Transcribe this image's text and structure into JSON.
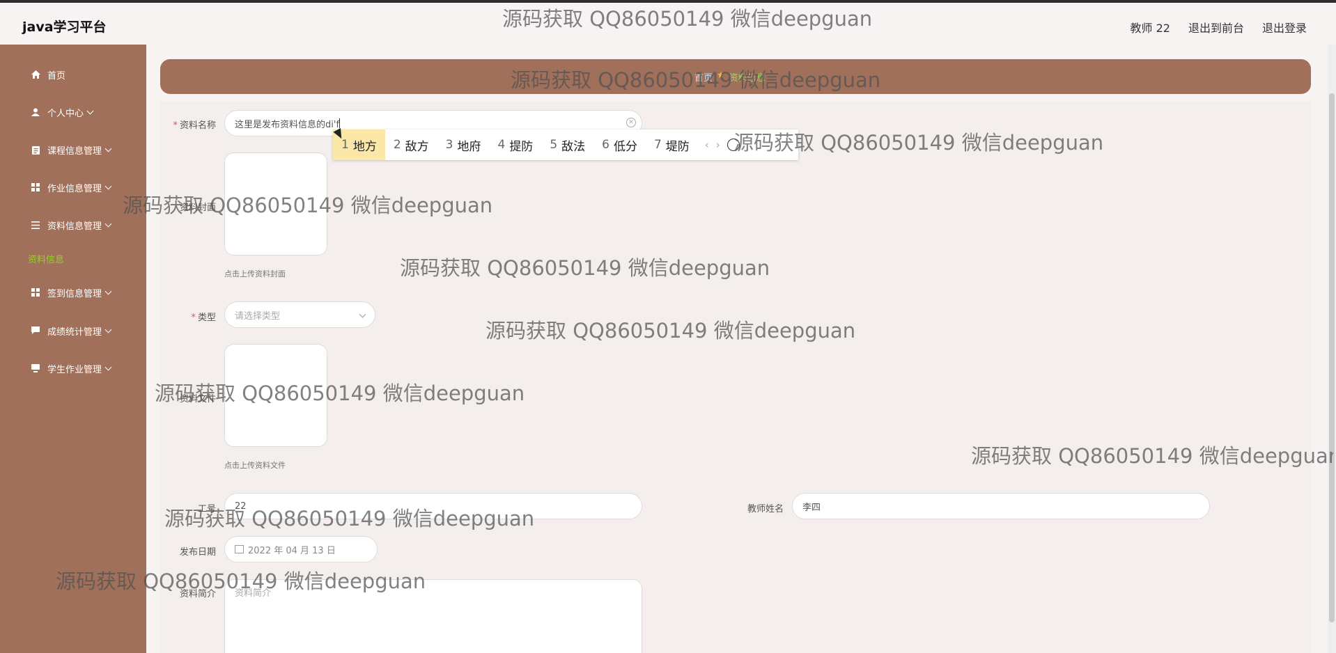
{
  "header": {
    "brand": "java学习平台",
    "user": "教师 22",
    "to_front": "退出到前台",
    "logout": "退出登录"
  },
  "sidebar": {
    "items": [
      {
        "label": "首页",
        "icon": "home-icon"
      },
      {
        "label": "个人中心",
        "icon": "user-icon"
      },
      {
        "label": "课程信息管理",
        "icon": "clipboard-icon"
      },
      {
        "label": "作业信息管理",
        "icon": "grid-icon"
      },
      {
        "label": "资料信息管理",
        "icon": "list-icon"
      },
      {
        "label": "签到信息管理",
        "icon": "grid-icon"
      },
      {
        "label": "成绩统计管理",
        "icon": "chat-icon"
      },
      {
        "label": "学生作业管理",
        "icon": "monitor-icon"
      }
    ],
    "active_sub": "资料信息"
  },
  "breadcrumb": {
    "home": "首页",
    "current": "资料信息"
  },
  "form": {
    "name_label": "资料名称",
    "name_value": "这里是发布资料信息的di'f",
    "cover_label": "资料封面",
    "cover_hint": "点击上传资料封面",
    "type_label": "类型",
    "type_placeholder": "请选择类型",
    "file_label": "资料文件",
    "file_hint": "点击上传资料文件",
    "job_no_label": "工号",
    "job_no_value": "22",
    "teacher_label": "教师姓名",
    "teacher_value": "李四",
    "date_label": "发布日期",
    "date_value": "2022 年 04 月 13 日",
    "intro_label": "资料简介",
    "intro_placeholder": "资料简介"
  },
  "ime": {
    "candidates": [
      {
        "num": "1",
        "text": "地方"
      },
      {
        "num": "2",
        "text": "敌方"
      },
      {
        "num": "3",
        "text": "地府"
      },
      {
        "num": "4",
        "text": "提防"
      },
      {
        "num": "5",
        "text": "敌法"
      },
      {
        "num": "6",
        "text": "低分"
      },
      {
        "num": "7",
        "text": "堤防"
      }
    ],
    "prev": "‹",
    "next": "›"
  },
  "watermark": "源码获取 QQ86050149 微信deepguan",
  "colors": {
    "sidebar": "#a0705a",
    "active": "#9acd32",
    "candidate_highlight": "#fbe7a8"
  }
}
